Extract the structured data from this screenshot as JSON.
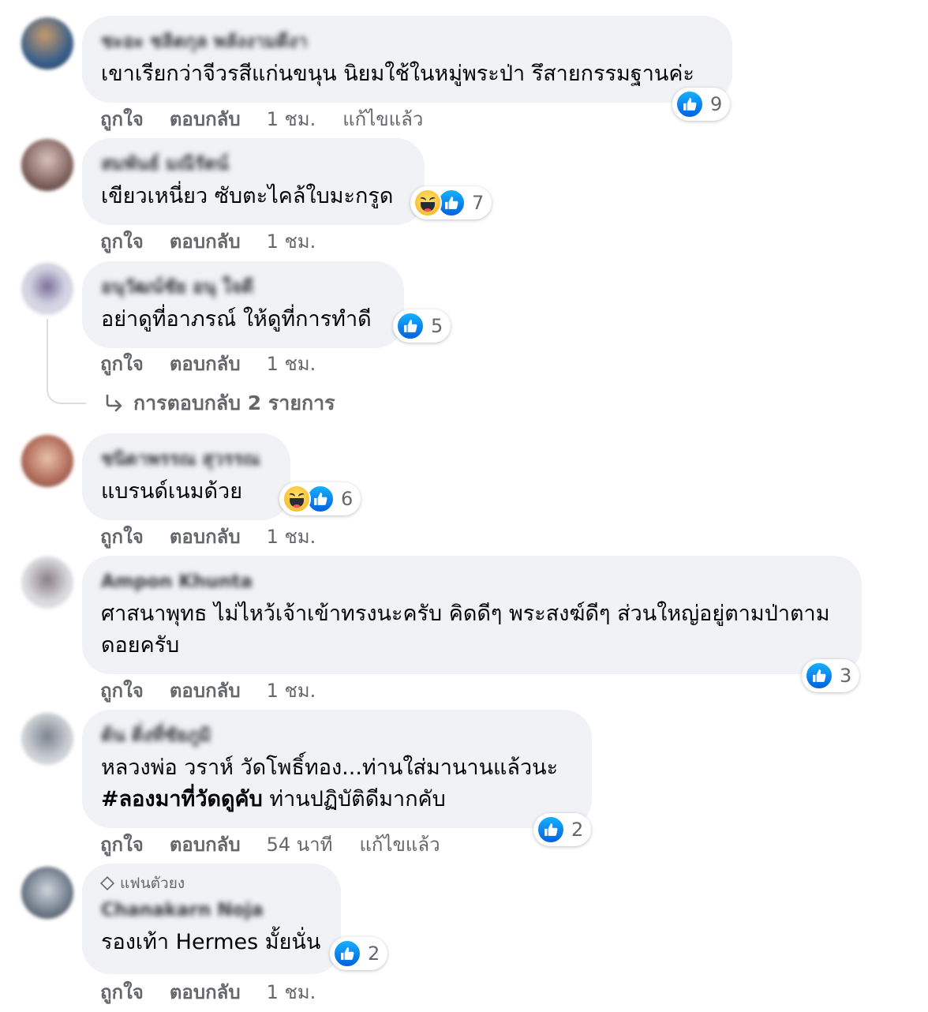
{
  "labels": {
    "like": "ถูกใจ",
    "reply": "ตอบกลับ",
    "edited": "แก้ไขแล้ว"
  },
  "comments": [
    {
      "author": "ชะอะ ชลิตกุล พลังงามดีงา",
      "text": "เขาเรียกว่าจีวรสีแก่นขนุน นิยมใช้ในหมู่พระป่า รึสายกรรมฐานค่ะ",
      "reactions": [
        "like"
      ],
      "reaction_count": "9",
      "time": "1 ชม.",
      "edited": true,
      "avatar_colors": [
        "#3a5f8a",
        "#c49a6c"
      ]
    },
    {
      "author": "สมพันธ์ มณีรัตน์",
      "text": "เขียวเหนี่ยว ซับตะไคล้ใบมะกรูด",
      "reactions": [
        "haha",
        "like"
      ],
      "reaction_count": "7",
      "time": "1 ชม.",
      "edited": false,
      "avatar_colors": [
        "#7a5c58",
        "#d9c2bb"
      ]
    },
    {
      "author": "อนุวัฒน์ชัย อนุ ใจดี",
      "text": "อย่าดูที่อาภรณ์ ให้ดูที่การทำดี",
      "reactions": [
        "like"
      ],
      "reaction_count": "5",
      "time": "1 ชม.",
      "edited": false,
      "avatar_colors": [
        "#cfcfe0",
        "#7b6f9a"
      ]
    },
    {
      "author": "ชนิดาพรรณ สุวรรณ",
      "text": "แบรนด์เนมด้วย",
      "reactions": [
        "haha",
        "like"
      ],
      "reaction_count": "6",
      "time": "1 ชม.",
      "edited": false,
      "avatar_colors": [
        "#b4705e",
        "#e8c2a6"
      ]
    },
    {
      "author": "Ampon Khunta",
      "text": "ศาสนาพุทธ ไม่ไหว้เจ้าเข้าทรงนะครับ คิดดีๆ พระสงฆ์ดีๆ ส่วนใหญ่อยู่ตามป่าตามดอยครับ",
      "reactions": [
        "like"
      ],
      "reaction_count": "3",
      "time": "1 ชม.",
      "edited": false,
      "avatar_colors": [
        "#d8d8dc",
        "#8a7f86"
      ]
    },
    {
      "author": "ต้น ติ่งที่ชัยภูมิ",
      "text_main": "หลวงพ่อ วราห์ วัดโพธิ์ทอง...ท่านใส่มานานแล้วนะ",
      "text_tag": "#ลองมาที่วัดดูคับ",
      "text_after": " ท่านปฏิบัติดีมากคับ",
      "reactions": [
        "like"
      ],
      "reaction_count": "2",
      "time": "54 นาที",
      "edited": true,
      "avatar_colors": [
        "#c9ccd1",
        "#7b8491"
      ]
    },
    {
      "badge": "แฟนตัวยง",
      "author": "Chanakarn Noja",
      "text": "รองเท้า Hermes มั้ยนั่น",
      "reactions": [
        "like"
      ],
      "reaction_count": "2",
      "time": "1 ชม.",
      "edited": false,
      "avatar_colors": [
        "#6e7a88",
        "#cfd6dd"
      ]
    }
  ],
  "replies_link": "การตอบกลับ 2 รายการ"
}
